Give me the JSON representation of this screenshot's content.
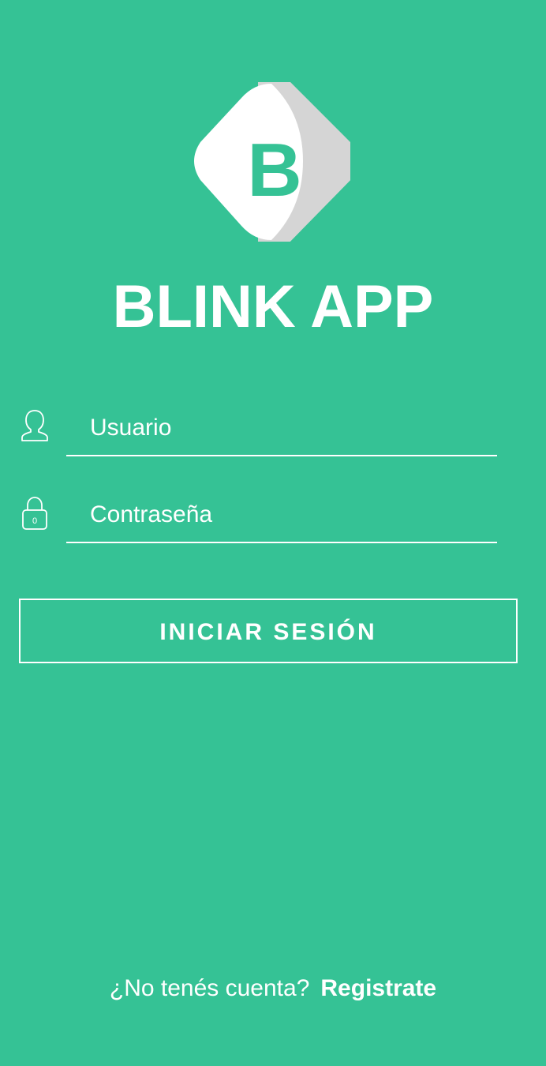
{
  "colors": {
    "background": "#35c295",
    "accent": "#35c295",
    "foreground": "#ffffff",
    "logo_shadow": "#d5d5d5"
  },
  "logo": {
    "letter": "B",
    "icon": "diamond-logo-icon"
  },
  "app_title": "BLINK APP",
  "form": {
    "username": {
      "placeholder": "Usuario",
      "value": "",
      "icon": "user-icon"
    },
    "password": {
      "placeholder": "Contraseña",
      "value": "",
      "icon": "lock-icon",
      "lock_digit": "0"
    }
  },
  "login_button": {
    "label": "INICIAR SESIÓN"
  },
  "footer": {
    "prompt": "¿No tenés cuenta?",
    "register_link": "Registrate"
  }
}
